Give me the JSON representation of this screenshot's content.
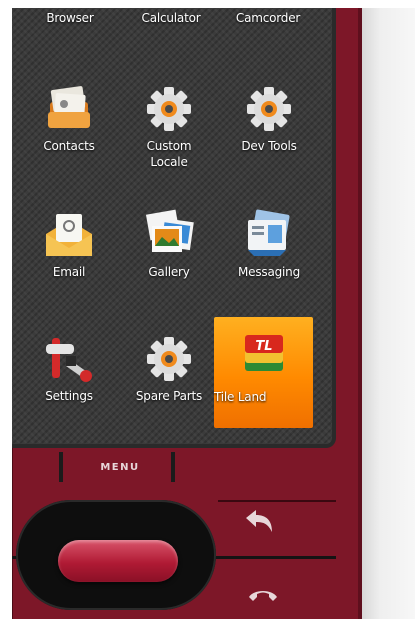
{
  "top_row": [
    {
      "label": "Browser"
    },
    {
      "label": "Calculator"
    },
    {
      "label": "Camcorder"
    }
  ],
  "apps": [
    {
      "label": "Contacts",
      "icon": "contacts-icon"
    },
    {
      "label": "Custom\nLocale",
      "icon": "gear-icon"
    },
    {
      "label": "Dev Tools",
      "icon": "gear-icon"
    },
    {
      "label": "Email",
      "icon": "email-icon"
    },
    {
      "label": "Gallery",
      "icon": "gallery-icon"
    },
    {
      "label": "Messaging",
      "icon": "messaging-icon"
    },
    {
      "label": "Settings",
      "icon": "settings-icon"
    },
    {
      "label": "Spare Parts",
      "icon": "gear-icon"
    },
    {
      "label": "Tile Land",
      "icon": "tile-land-icon",
      "selected": true
    }
  ],
  "hardware": {
    "menu_label": "MENU"
  },
  "colors": {
    "body": "#7d1728",
    "selected": "#ff8a00",
    "screen": "#3b3b3b"
  }
}
